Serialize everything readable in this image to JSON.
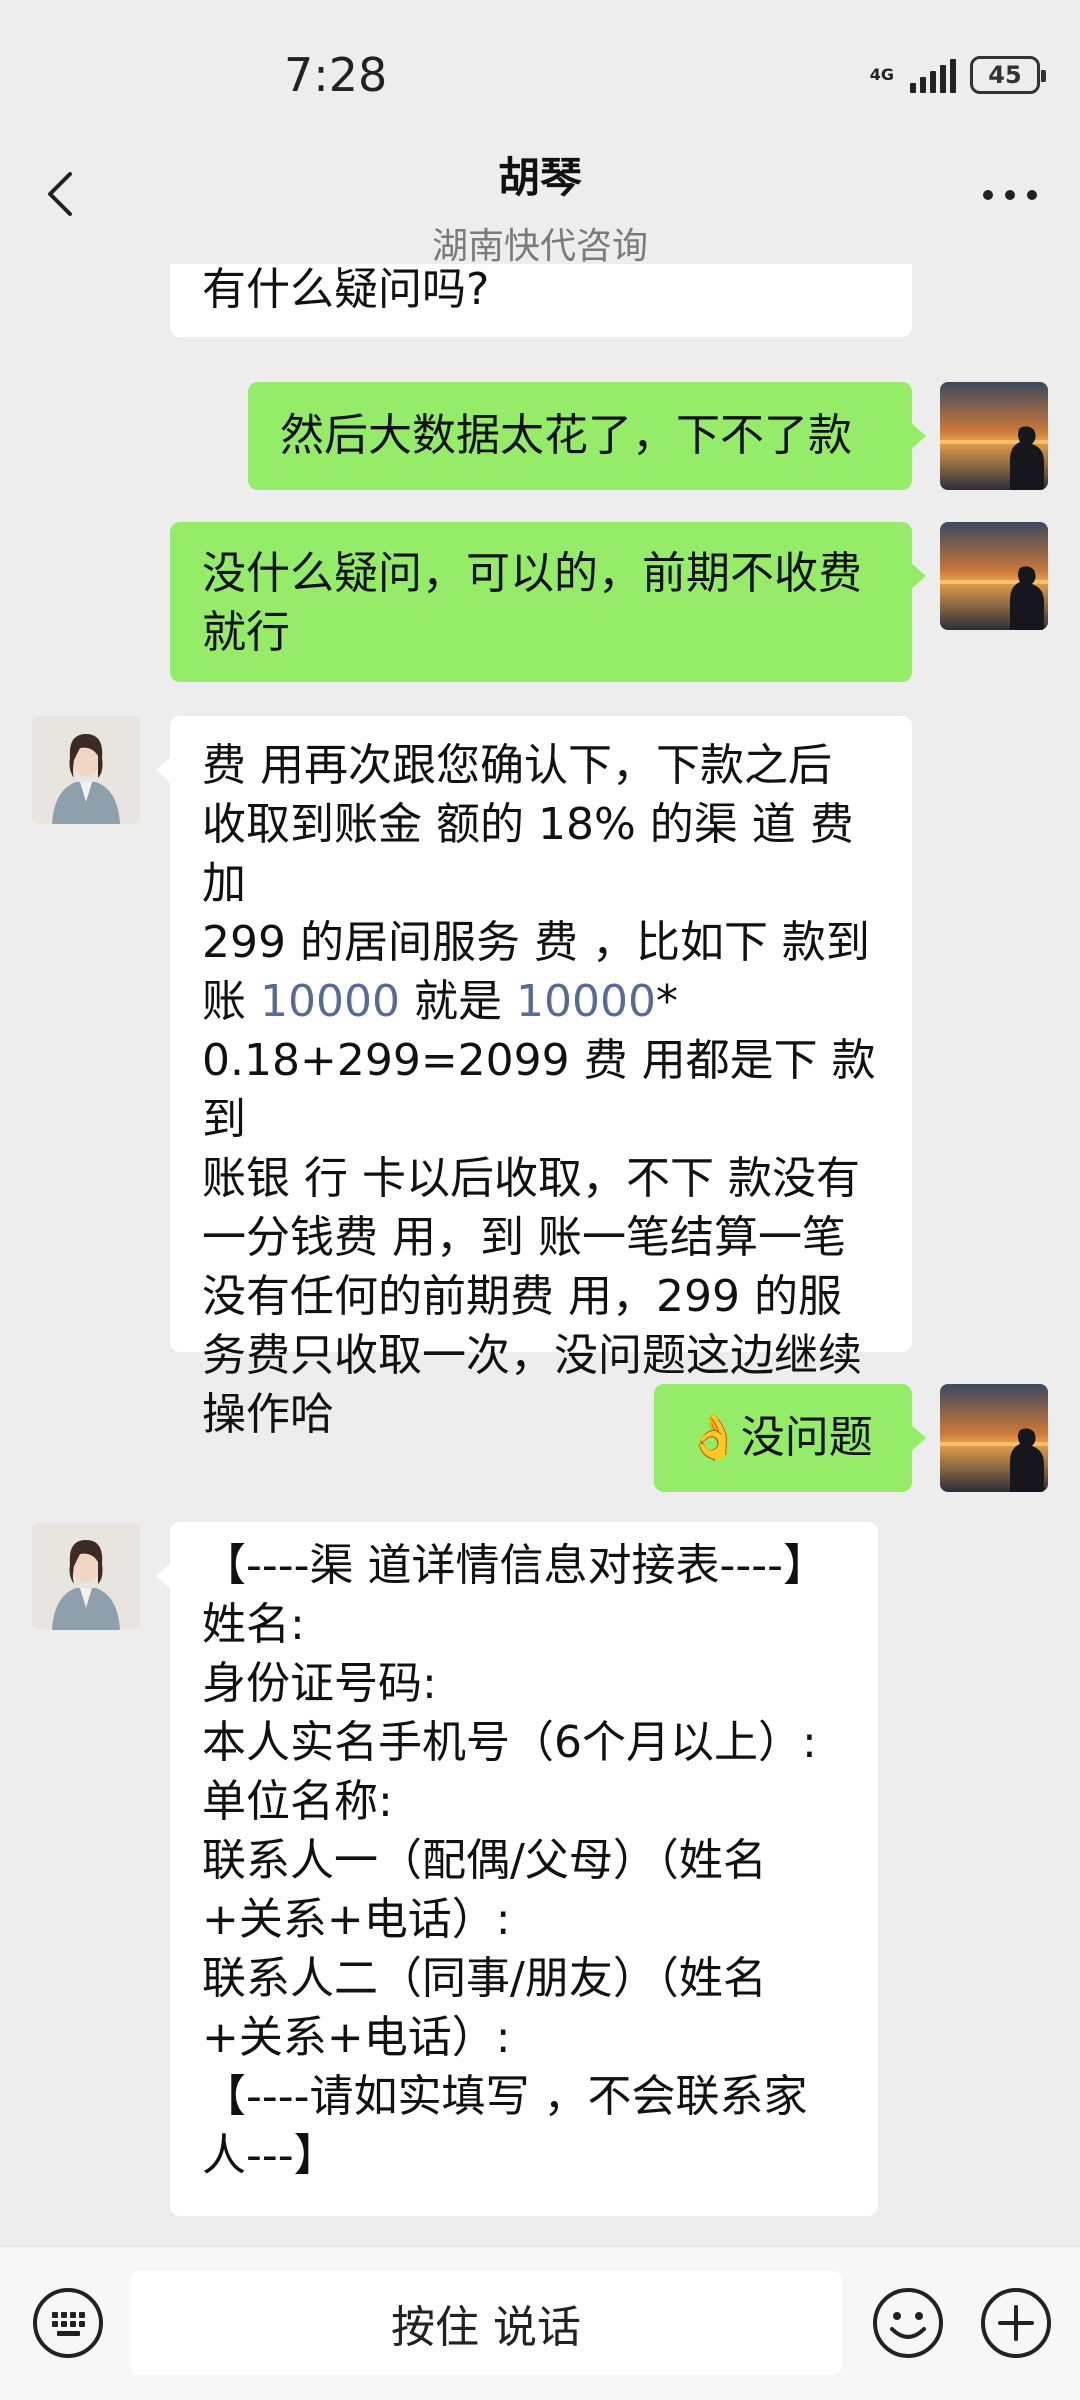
{
  "status": {
    "time": "7:28",
    "network": "4G",
    "battery": "45"
  },
  "header": {
    "title": "胡琴",
    "subtitle": "湖南快代咨询"
  },
  "messages": [
    {
      "side": "in",
      "lines": [
        "有什么疑问吗?"
      ]
    },
    {
      "side": "out",
      "lines": [
        "然后大数据太花了，下不了款"
      ]
    },
    {
      "side": "out",
      "lines": [
        "没什么疑问，可以的，前期不收费",
        "就行"
      ]
    },
    {
      "side": "in",
      "lines": [
        "费 用再次跟您确认下，下款之后",
        "收取到账金 额的 18% 的渠 道 费加",
        "299 的居间服务 费 ，比如下 款到",
        "账 10000 就是 10000*",
        "0.18+299=2099 费 用都是下 款到",
        "账银 行 卡以后收取，不下 款没有",
        "一分钱费 用，到 账一笔结算一笔",
        "没有任何的前期费 用，299 的服",
        "务费只收取一次，没问题这边继续",
        "操作哈"
      ]
    },
    {
      "side": "out",
      "emoji": "👌",
      "text": "没问题"
    },
    {
      "side": "in",
      "lines": [
        "【----渠 道详情信息对接表----】",
        "姓名:",
        "身份证号码:",
        "本人实名手机号（6个月以上）:",
        "单位名称:",
        "联系人一（配偶/父母）（姓名",
        "+关系+电话）:",
        "联系人二（同事/朋友）（姓名",
        "+关系+电话）:",
        "【----请如实填写 ，不会联系家",
        "人---】"
      ]
    }
  ],
  "link_segments": {
    "prefix": "账 ",
    "num1": "10000",
    "middle": " 就是 ",
    "num2": "10000",
    "suffix": "*"
  },
  "input": {
    "hold_to_talk": "按住 说话"
  },
  "colors": {
    "outgoing_bubble": "#95ec69",
    "incoming_bubble": "#ffffff",
    "background": "#ededed",
    "link": "#576b95"
  },
  "icons": [
    "back-icon",
    "more-icon",
    "keyboard-icon",
    "emoji-icon",
    "plus-icon"
  ]
}
